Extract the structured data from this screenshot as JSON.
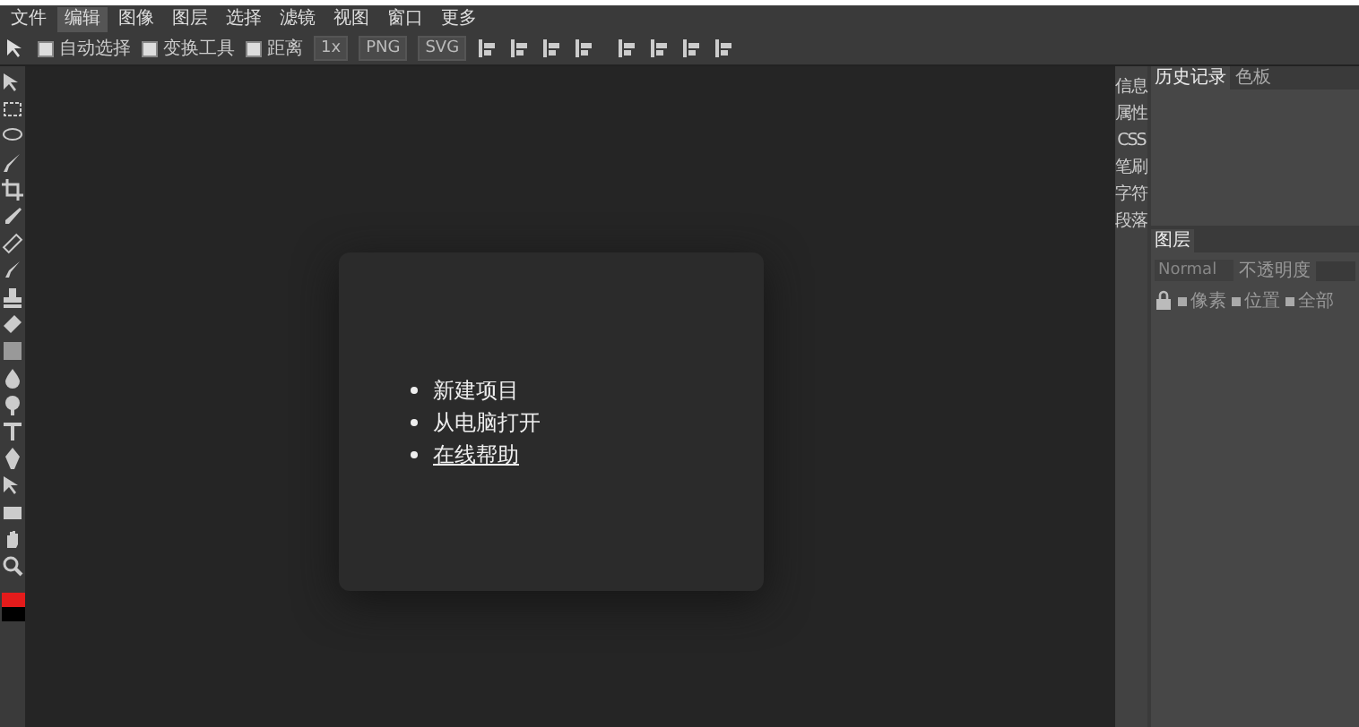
{
  "menu": [
    {
      "label": "文件",
      "selected": false
    },
    {
      "label": "编辑",
      "selected": true
    },
    {
      "label": "图像",
      "selected": false
    },
    {
      "label": "图层",
      "selected": false
    },
    {
      "label": "选择",
      "selected": false
    },
    {
      "label": "滤镜",
      "selected": false
    },
    {
      "label": "视图",
      "selected": false
    },
    {
      "label": "窗口",
      "selected": false
    },
    {
      "label": "更多",
      "selected": false
    }
  ],
  "toolbar": {
    "options": [
      {
        "label": "自动选择",
        "checked": false
      },
      {
        "label": "变换工具",
        "checked": false
      },
      {
        "label": "距离",
        "checked": false
      }
    ],
    "scale": "1x",
    "export_buttons": [
      "PNG",
      "SVG"
    ]
  },
  "swatches": [
    {
      "color": "#e41b1b"
    },
    {
      "color": "#000000"
    }
  ],
  "start_menu": [
    {
      "label": "新建项目",
      "kind": "plain"
    },
    {
      "label": "从电脑打开",
      "kind": "plain"
    },
    {
      "label": "在线帮助",
      "kind": "link"
    }
  ],
  "side_tabs": [
    "信息",
    "属性",
    "CSS",
    "笔刷",
    "字符",
    "段落"
  ],
  "history_panel": {
    "tabs": [
      {
        "label": "历史记录",
        "selected": true
      },
      {
        "label": "色板",
        "selected": false
      }
    ]
  },
  "layers_panel": {
    "title": "图层",
    "blend_mode": "Normal",
    "opacity_label": "不透明度",
    "locks": [
      {
        "label": "像素",
        "checked": false
      },
      {
        "label": "位置",
        "checked": false
      },
      {
        "label": "全部",
        "checked": false
      }
    ]
  }
}
